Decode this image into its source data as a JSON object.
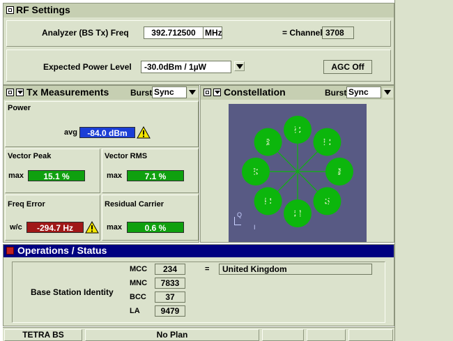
{
  "rf_settings": {
    "title": "RF Settings",
    "freq_label": "Analyzer (BS Tx) Freq",
    "freq_value": "392.712500",
    "freq_unit": "MHz",
    "channel_label": "= Channel",
    "channel_value": "3708",
    "power_label": "Expected Power Level",
    "power_value": "-30.0dBm / 1µW",
    "agc_label": "AGC Off"
  },
  "tx_measurements": {
    "title": "Tx Measurements",
    "burst_label": "Burst",
    "burst_value": "Sync",
    "power": {
      "label": "Power",
      "qualifier": "avg",
      "value": "-84.0 dBm",
      "color": "#1b3ed6"
    },
    "vector_peak": {
      "label": "Vector Peak",
      "qualifier": "max",
      "value": "15.1 %",
      "color": "#0fa00f"
    },
    "vector_rms": {
      "label": "Vector RMS",
      "qualifier": "max",
      "value": "7.1 %",
      "color": "#0fa00f"
    },
    "freq_error": {
      "label": "Freq Error",
      "qualifier": "w/c",
      "value": "-294.7 Hz",
      "color": "#a01818"
    },
    "residual_carrier": {
      "label": "Residual Carrier",
      "qualifier": "max",
      "value": "0.6 %",
      "color": "#0fa00f"
    }
  },
  "constellation": {
    "title": "Constellation",
    "burst_label": "Burst",
    "burst_value": "Sync",
    "q_axis": "Q",
    "i_axis": "I",
    "background_color": "#585a84",
    "point_color": "#0cb60c"
  },
  "operations": {
    "title": "Operations / Status",
    "bsi_label": "Base Station Identity",
    "rows": [
      {
        "key": "MCC",
        "value": "234"
      },
      {
        "key": "MNC",
        "value": "7833"
      },
      {
        "key": "BCC",
        "value": "37"
      },
      {
        "key": "LA",
        "value": "9479"
      }
    ],
    "equals": "=",
    "country": "United Kingdom",
    "header_color": "#000080"
  },
  "status_bar": {
    "mode": "TETRA BS",
    "plan": "No Plan"
  }
}
